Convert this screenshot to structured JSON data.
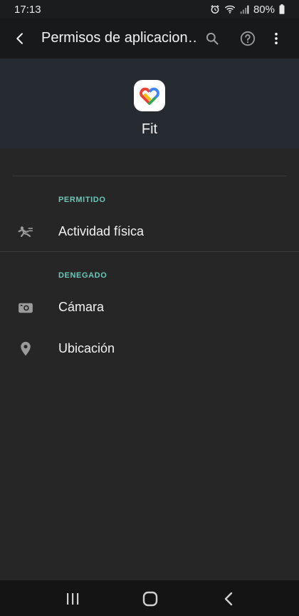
{
  "status_bar": {
    "time": "17:13",
    "battery": "80%",
    "icons": [
      "alarm-icon",
      "wifi-icon",
      "signal-icon",
      "battery-icon"
    ]
  },
  "app_bar": {
    "title": "Permisos de aplicacion…",
    "icons": [
      "back-arrow-icon",
      "search-icon",
      "help-icon",
      "more-vert-icon"
    ]
  },
  "header": {
    "app_name": "Fit",
    "app_icon": "google-fit-heart-icon"
  },
  "sections": {
    "allowed": {
      "label": "PERMITIDO",
      "items": [
        {
          "label": "Actividad física",
          "icon": "physical-activity-icon"
        }
      ]
    },
    "denied": {
      "label": "DENEGADO",
      "items": [
        {
          "label": "Cámara",
          "icon": "camera-icon"
        },
        {
          "label": "Ubicación",
          "icon": "location-pin-icon"
        }
      ]
    }
  },
  "nav_bar": {
    "icons": [
      "recents-icon",
      "home-icon",
      "back-icon"
    ]
  },
  "colors": {
    "accent": "#6cc6b8",
    "background": "#262626",
    "header_bg": "#252b30",
    "app_bar_bg": "#18191b"
  }
}
